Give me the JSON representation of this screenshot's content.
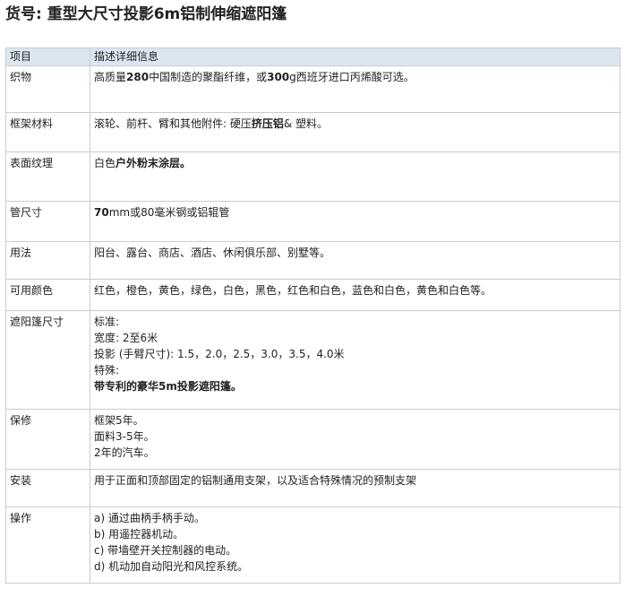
{
  "title": "货号: 重型大尺寸投影6m铝制伸缩遮阳篷",
  "table": {
    "headers": [
      "项目",
      "描述详细信息"
    ],
    "rows": [
      {
        "label": "织物",
        "lines": [
          [
            {
              "text": "高质量"
            },
            {
              "text": "280",
              "bold": true
            },
            {
              "text": "中国制造的聚酯纤维，或"
            },
            {
              "text": "300",
              "bold": true
            },
            {
              "text": "g西班牙进口丙烯酸可选。"
            }
          ]
        ]
      },
      {
        "label": "框架材料",
        "lines": [
          [
            {
              "text": "滚轮、前杆、臂和其他附件: 硬压"
            },
            {
              "text": "挤压铝",
              "bold": true
            },
            {
              "text": "& 塑料。"
            }
          ]
        ]
      },
      {
        "label": "表面纹理",
        "lines": [
          [
            {
              "text": "白色"
            },
            {
              "text": "户外粉末涂层。",
              "bold": true
            }
          ]
        ]
      },
      {
        "label": "管尺寸",
        "lines": [
          [
            {
              "text": "70",
              "bold": true
            },
            {
              "text": "mm或80毫米钢或铝辊管"
            }
          ]
        ]
      },
      {
        "label": "用法",
        "lines": [
          [
            {
              "text": "阳台、露台、商店、酒店、休闲俱乐部、别墅等。"
            }
          ]
        ]
      },
      {
        "label": "可用颜色",
        "lines": [
          [
            {
              "text": "红色，橙色，黄色，绿色，白色，黑色，红色和白色，蓝色和白色，黄色和白色等。"
            }
          ]
        ]
      },
      {
        "label": "遮阳篷尺寸",
        "lines": [
          [
            {
              "text": "标准:"
            }
          ],
          [
            {
              "text": "宽度: 2至6米"
            }
          ],
          [
            {
              "text": "投影 (手臂尺寸): 1.5，2.0，2.5，3.0，3.5，4.0米"
            }
          ],
          [
            {
              "text": "特殊:"
            }
          ],
          [
            {
              "text": "带专利的豪华5m投影遮阳篷。",
              "bold": true
            }
          ]
        ]
      },
      {
        "label": "保修",
        "lines": [
          [
            {
              "text": "框架5年。"
            }
          ],
          [
            {
              "text": "面料3-5年。"
            }
          ],
          [
            {
              "text": "2年的汽车。"
            }
          ]
        ]
      },
      {
        "label": "安装",
        "lines": [
          [
            {
              "text": "用于正面和顶部固定的铝制通用支架，以及适合特殊情况的预制支架"
            }
          ]
        ]
      },
      {
        "label": "操作",
        "lines": [
          [
            {
              "text": "a) 通过曲柄手柄手动。"
            }
          ],
          [
            {
              "text": "b) 用遥控器机动。"
            }
          ],
          [
            {
              "text": "c) 带墙壁开关控制器的电动。"
            }
          ],
          [
            {
              "text": "d) 机动加自动阳光和风控系统。"
            }
          ]
        ]
      }
    ]
  }
}
